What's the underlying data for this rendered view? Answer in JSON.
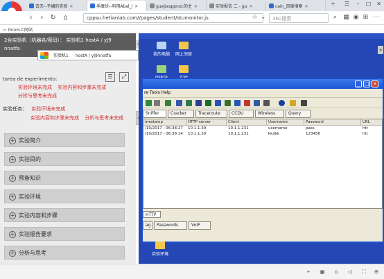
{
  "browser": {
    "tabs": [
      {
        "label": "去天--予编的实验",
        "color": "#2d6bd6"
      },
      {
        "label": "手康伏--利用Abal_l",
        "color": "#2d6bd6"
      },
      {
        "label": "guejiasppnoc的主",
        "color": "#666666"
      },
      {
        "label": "实验报告 二 - gu",
        "color": "#666666"
      },
      {
        "label": "cain_百度搜索",
        "color": "#2d6bd6"
      }
    ],
    "url": "cppsu.hetianlab.com//pages/student/stumonitor.js",
    "search_placeholder": "360搜索",
    "bookmark": "Ibrom上网站"
  },
  "left": {
    "head_line1": "2台实验机（机器名/密码）： 实验机1  hostA / yJ9",
    "head_line2": "nnatfa",
    "experiment_label": "tarea de experimento:",
    "links_a": [
      "实验环境未完成",
      "实验内容和步骤未完成"
    ],
    "links_b": "分析与思考未完成",
    "task_label": "实验任务：",
    "task_links_a": "实验环境未完成",
    "task_links_b": [
      "实验内容和步骤未完成",
      "分析与思考未完成"
    ],
    "menu": [
      "实验简介",
      "实验目的",
      "预备知识",
      "实验环境",
      "实验内容和步骤",
      "实验报告要求",
      "分析与思考"
    ]
  },
  "overlay": {
    "label": "实验机1",
    "credential": "hostA / yJ9nnatfa"
  },
  "desktop": {
    "icons": [
      "我的电脑",
      "网上邻居",
      "回收站",
      "实验"
    ],
    "top_labels": [
      "",
      "",
      "",
      "",
      ""
    ],
    "bottom_icon": "实验环境"
  },
  "sniffer": {
    "menu": "re  Tools  Help",
    "toolbar_tabs": [
      "Sniffer",
      "Cracker",
      "Traceroute",
      "CCDU",
      "Wireless",
      "Query"
    ],
    "columns": [
      "mestamp",
      "HTTP server",
      "Client",
      "Username",
      "Password",
      "URL"
    ],
    "rows": [
      [
        "/10/2017 - 06:38:27",
        "10.1.1.39",
        "10.1.1.231",
        "username",
        "pass",
        "htt"
      ],
      [
        "/10/2017 - 06:38:14",
        "10.1.1.39",
        "10.1.1.231",
        "kkdkk",
        "123456",
        "htt"
      ]
    ],
    "mid_tab": "HTTP",
    "bottom_tabs": [
      "ag",
      "Passwords",
      "VoIP"
    ]
  }
}
